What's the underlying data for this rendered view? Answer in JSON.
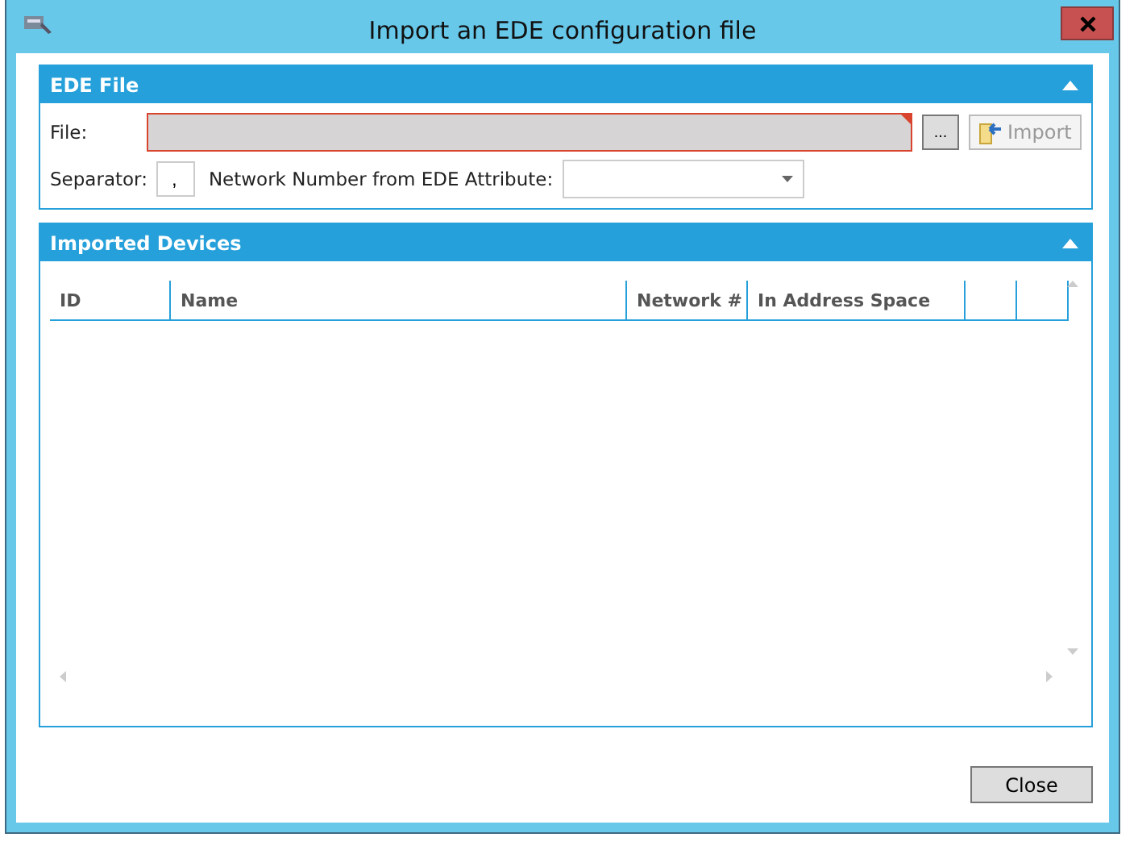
{
  "window": {
    "title": "Import an EDE configuration file"
  },
  "ede_file": {
    "title": "EDE File",
    "expanded": true,
    "file": {
      "label": "File:",
      "invalid": true
    },
    "browse_button": "...",
    "import_button": {
      "label": "Import",
      "disabled": true
    },
    "separator": {
      "label": "Separator:",
      "value": ","
    },
    "network_number": {
      "label": "Network Number from EDE Attribute:"
    }
  },
  "imported_devices": {
    "title": "Imported Devices",
    "expanded": true,
    "columns": [
      "ID",
      "Name",
      "Network #",
      "In Address Space"
    ]
  },
  "buttons": [
    "Close"
  ]
}
